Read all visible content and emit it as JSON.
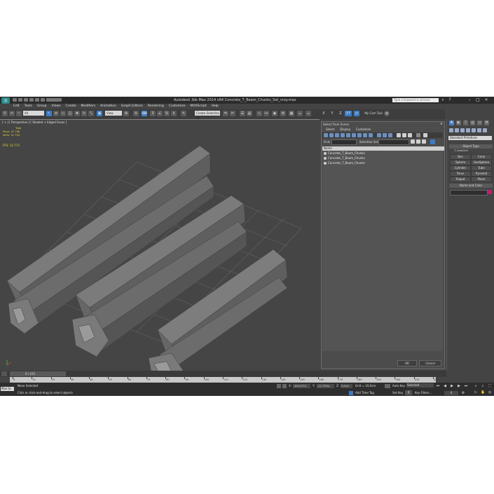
{
  "app": {
    "title": "Autodesk 3ds Max 2014 x64     Concrete_T_Beam_Chunks_Set_vray.max",
    "search_placeholder": "Type a keyword or phrase",
    "logo": "3ds-max-logo"
  },
  "menu": [
    "Edit",
    "Tools",
    "Group",
    "Views",
    "Create",
    "Modifiers",
    "Animation",
    "Graph Editors",
    "Rendering",
    "Customize",
    "MAXScript",
    "Help"
  ],
  "toolbar": {
    "selection_set": "All",
    "ref_coord": "View",
    "named_sel": "Create Selection Se",
    "xyz": [
      "X",
      "Y",
      "Z",
      "XY"
    ]
  },
  "viewport": {
    "label": "[ + ] [ Perspective ] [ Shaded + Edged Faces ]",
    "stats": {
      "total_label": "Total",
      "polys_label": "Polys:",
      "polys_value": "47 708",
      "verts_label": "Verts:",
      "verts_value": "31 754",
      "fps_label": "FPS:",
      "fps_value": "32.773"
    }
  },
  "scene_explorer": {
    "title": "Select From Scene",
    "menus": [
      "Select",
      "Display",
      "Customize"
    ],
    "find_label": "Find:",
    "selection_set_label": "Selection Set:",
    "column_header": "Name",
    "rows": [
      "Concrete_T_Beam_Chunks",
      "Concrete_T_Beam_Chunks",
      "Concrete_T_Beam_Chunks"
    ],
    "ok_label": "OK",
    "cancel_label": "Cancel"
  },
  "command_panel": {
    "category": "Standard Primitives",
    "object_type_title": "Object Type",
    "autogrid_label": "AutoGrid",
    "primitives": [
      "Box",
      "Cone",
      "Sphere",
      "GeoSphere",
      "Cylinder",
      "Tube",
      "Torus",
      "Pyramid",
      "Teapot",
      "Plane"
    ],
    "name_color_title": "Name and Color",
    "color": "#c01f6e"
  },
  "timeline": {
    "slider_label": "0 / 225",
    "ticks": [
      "0",
      "10",
      "20",
      "30",
      "40",
      "50",
      "60",
      "70",
      "80",
      "90",
      "100",
      "110",
      "120",
      "130",
      "140",
      "150",
      "160",
      "170",
      "180",
      "190",
      "200",
      "210",
      "220"
    ]
  },
  "status": {
    "maxscript_label": "Max to",
    "selection": "None Selected",
    "prompt": "Click or click-and-drag to select objects",
    "x_label": "X:",
    "x_value": "-444,4713",
    "y_label": "Y:",
    "y_value": "-21,7334c",
    "z_label": "Z:",
    "z_value": "0,0cm",
    "grid": "Grid = 10,0cm",
    "add_time_tag": "Add Time Tag",
    "auto_key": "Auto Key",
    "selected": "Selected",
    "set_key": "Set Key",
    "key_filters": "Key Filters...",
    "frame": "0"
  },
  "icons": {
    "undo": "undo-icon",
    "redo": "redo-icon",
    "select": "select-arrow-icon",
    "move": "move-icon",
    "rotate": "rotate-icon",
    "scale": "scale-icon",
    "render": "teapot-render-icon"
  }
}
